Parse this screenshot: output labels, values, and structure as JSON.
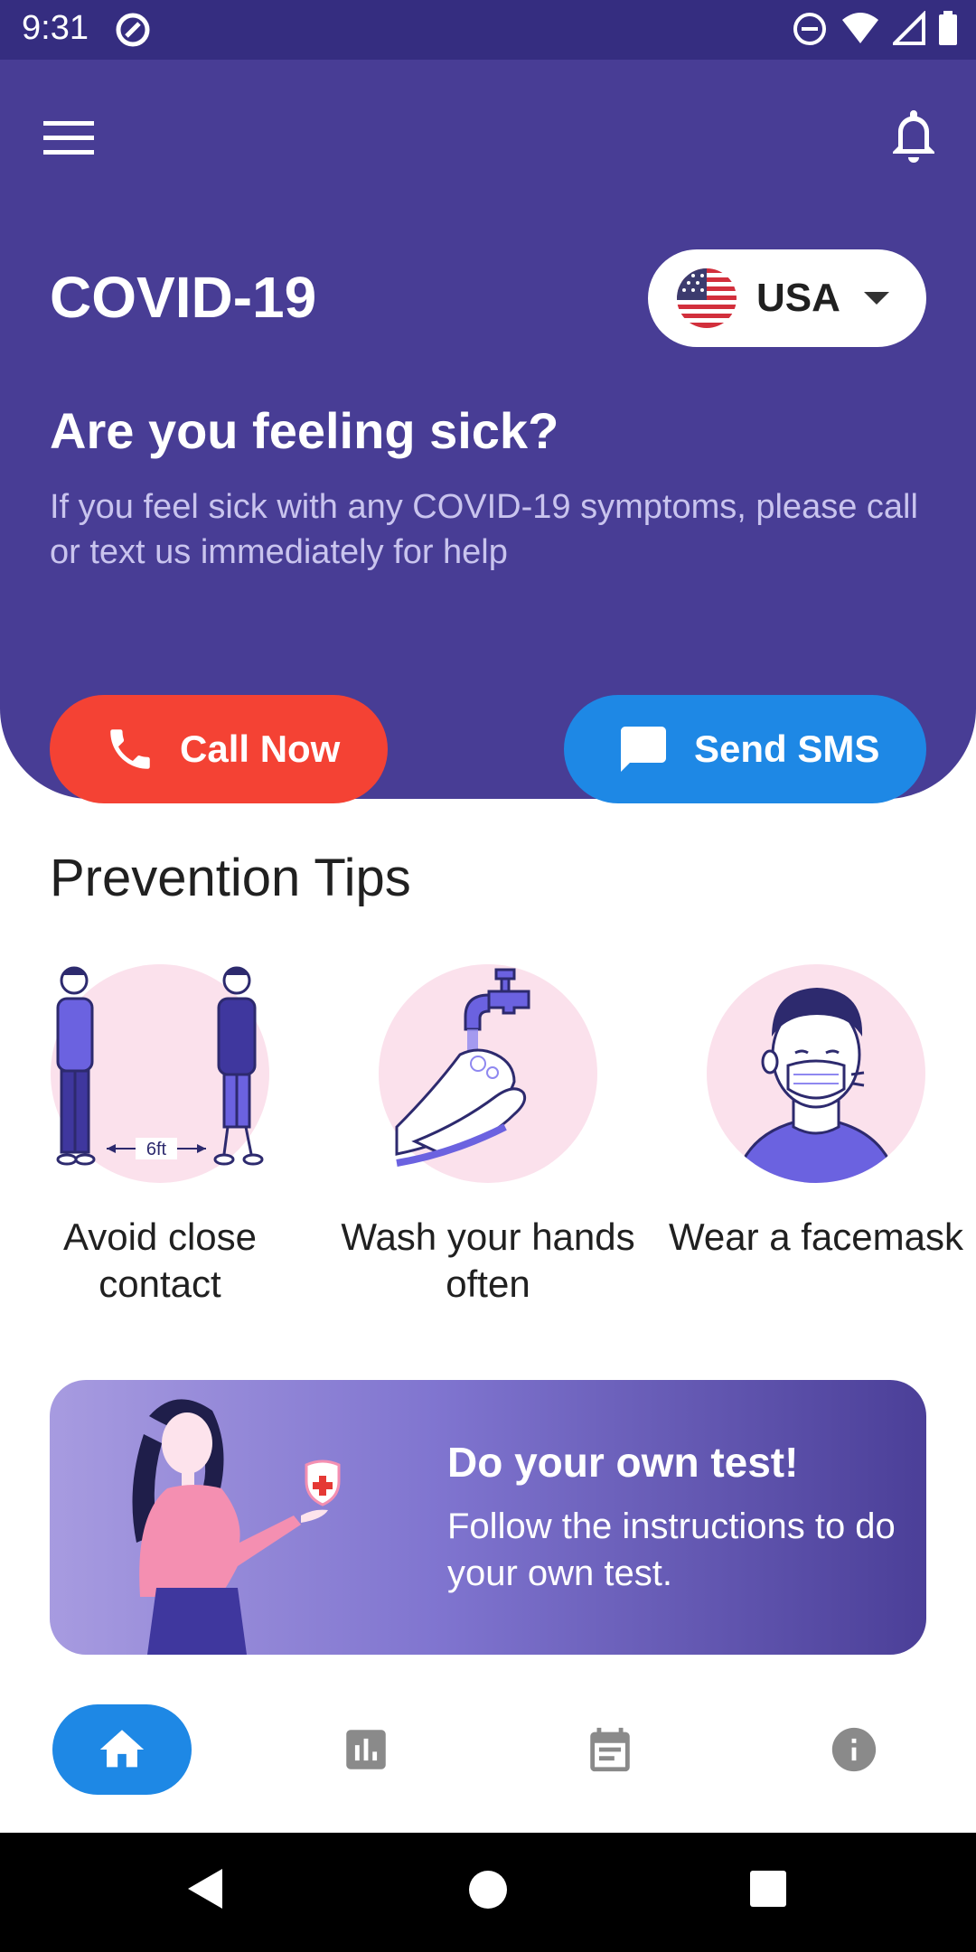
{
  "status_bar": {
    "time": "9:31"
  },
  "header": {
    "app_title": "COVID-19",
    "country": {
      "label": "USA"
    }
  },
  "hero": {
    "question": "Are you feeling sick?",
    "description": "If you feel sick with any COVID-19 symptoms, please call or text us immediately for help",
    "call_label": "Call Now",
    "sms_label": "Send SMS"
  },
  "prevention": {
    "title": "Prevention Tips",
    "tips": [
      {
        "label": "Avoid close contact",
        "illustration_text": "6ft"
      },
      {
        "label": "Wash your hands often"
      },
      {
        "label": "Wear a facemask"
      }
    ]
  },
  "banner": {
    "title": "Do your own test!",
    "description": "Follow the instructions to do your own test."
  },
  "bottom_nav": {
    "items": [
      {
        "icon": "home-icon",
        "active": true
      },
      {
        "icon": "bar-chart-icon",
        "active": false
      },
      {
        "icon": "calendar-icon",
        "active": false
      },
      {
        "icon": "info-icon",
        "active": false
      }
    ]
  },
  "colors": {
    "primary": "#483d95",
    "call": "#f44234",
    "sms": "#1e88e5",
    "tip_bg": "#fbe1ec"
  }
}
